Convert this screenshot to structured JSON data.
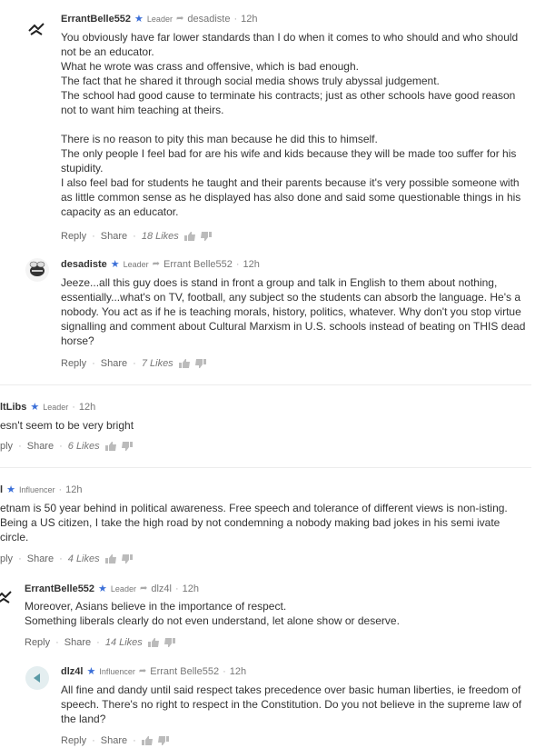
{
  "comments": [
    {
      "user": "ErrantBelle552",
      "badge": "Leader",
      "reply_to": "desadiste",
      "time": "12h",
      "paragraphs": [
        "You obviously have far lower standards than I do when it comes to who should and who should not be an educator.",
        "What he wrote was crass and offensive, which is bad enough.",
        "The fact that he shared it through social media shows truly abyssal judgement.",
        "The school had good cause to terminate his contracts; just as other schools have good reason not to want him teaching at theirs.",
        "",
        "There is no reason to pity this man because he did this to himself.",
        "The only people I feel bad for are his wife and kids because they will be made too suffer for his stupidity.",
        "I also feel bad for students he taught and their parents because it's very possible someone with as little common sense as he displayed has also done and said some questionable things in his capacity as an educator."
      ],
      "reply": "Reply",
      "share": "Share",
      "likes": "18 Likes"
    },
    {
      "user": "desadiste",
      "badge": "Leader",
      "reply_to": "Errant Belle552",
      "time": "12h",
      "paragraphs": [
        "Jeeze...all this guy does is stand in front a group and talk in English to them about nothing, essentially...what's on TV, football, any subject so the students can absorb the language. He's a nobody. You act as if he is teaching morals, history, politics, whatever. Why don't you stop virtue signalling and comment about Cultural Marxism in U.S. schools instead of beating on THIS dead horse?"
      ],
      "reply": "Reply",
      "share": "Share",
      "likes": "7 Likes"
    },
    {
      "user": "ltLibs",
      "badge": "Leader",
      "reply_to": "",
      "time": "12h",
      "paragraphs": [
        "esn't seem to be very bright"
      ],
      "reply": "ply",
      "share": "Share",
      "likes": "6 Likes"
    },
    {
      "user": "l",
      "badge": "Influencer",
      "reply_to": "",
      "time": "12h",
      "paragraphs": [
        "etnam is 50 year behind in political awareness. Free speech and tolerance of different views is non-isting. Being a US citizen, I take the high road by not condemning a nobody making bad jokes in his semi ivate circle."
      ],
      "reply": "ply",
      "share": "Share",
      "likes": "4 Likes"
    },
    {
      "user": "ErrantBelle552",
      "badge": "Leader",
      "reply_to": "dlz4l",
      "time": "12h",
      "paragraphs": [
        "Moreover, Asians believe in the importance of respect.",
        "Something liberals clearly do not even understand, let alone show or deserve."
      ],
      "reply": "Reply",
      "share": "Share",
      "likes": "14 Likes"
    },
    {
      "user": "dlz4l",
      "badge": "Influencer",
      "reply_to": "Errant Belle552",
      "time": "12h",
      "paragraphs": [
        "All fine and dandy until said respect takes precedence over basic human liberties, ie freedom of speech. There's no right to respect in the Constitution. Do you not believe in the supreme law of the land?"
      ],
      "reply": "Reply",
      "share": "Share",
      "likes": ""
    }
  ]
}
